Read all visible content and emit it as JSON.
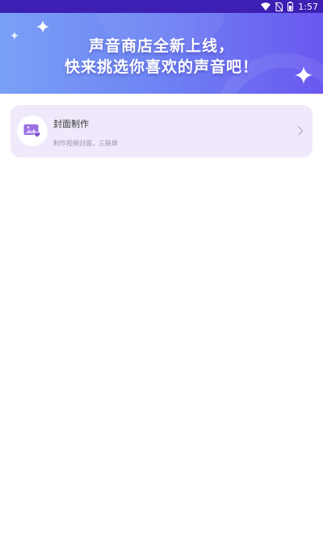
{
  "status_bar": {
    "time": "1:57",
    "icons": [
      "wifi-icon",
      "no-sim-icon",
      "battery-icon"
    ]
  },
  "banner": {
    "line1": "声音商店全新上线，",
    "line2": "快来挑选你喜欢的声音吧！"
  },
  "card": {
    "title": "封面制作",
    "description": "制作视频封面、三联屏",
    "icon": "cover-image-icon"
  },
  "colors": {
    "status_bar": "#3d1fb3",
    "banner_start": "#7aa0f6",
    "banner_end": "#6a58f0",
    "card_bg": "#efe9fb",
    "icon_purple": "#8b5bd8"
  }
}
